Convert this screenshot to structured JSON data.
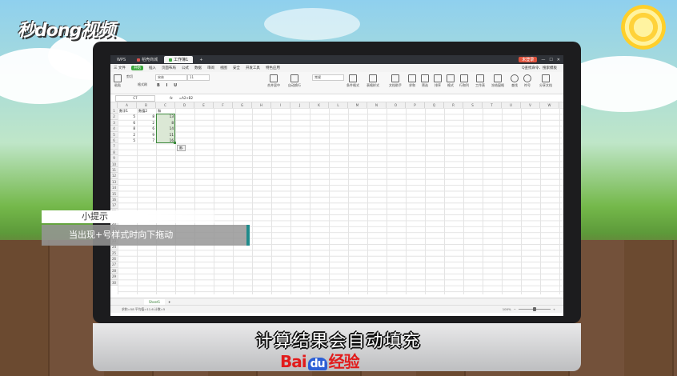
{
  "overlay": {
    "logo": "秒dong视频",
    "tip_title": "小提示",
    "tip_body": "当出现+号样式时向下拖动",
    "subtitle": "计算结果会自动填充",
    "watermark_prefix": "Bai",
    "watermark_du": "du",
    "watermark_suffix": "经验"
  },
  "titlebar": {
    "app": "WPS",
    "tabs": [
      {
        "label": "稻壳商城",
        "color": "#d9534f"
      },
      {
        "label": "工作簿1",
        "color": "#3da73d"
      }
    ],
    "new_tab": "+",
    "login": "未登录"
  },
  "menubar": {
    "file": "三 文件",
    "start": "开始",
    "items": [
      "插入",
      "页面布局",
      "公式",
      "数据",
      "审阅",
      "视图",
      "安全",
      "开发工具",
      "特色应用"
    ],
    "search": "Q查找命令、搜索模板"
  },
  "ribbon": {
    "paste": "粘贴",
    "cut": "剪切",
    "format_painter": "格式刷",
    "font_name": "宋体",
    "font_size": "11",
    "merge": "合并居中",
    "wrap": "自动换行",
    "number_format": "常规",
    "cond_format": "条件格式",
    "table_style": "表格样式",
    "doc_helper": "文档助手",
    "sum": "求和",
    "filter": "筛选",
    "sort": "排序",
    "format": "格式",
    "rowcol": "行和列",
    "worksheet": "工作表",
    "freeze": "冻结窗格",
    "find": "查找",
    "symbol": "符号",
    "share": "分享文档"
  },
  "formula_bar": {
    "cell_ref": "C7",
    "fx": "fx",
    "formula": "=A2+B2"
  },
  "sheet": {
    "columns": [
      "A",
      "B",
      "C",
      "D",
      "E",
      "F",
      "G",
      "H",
      "I",
      "J",
      "K",
      "L",
      "M",
      "N",
      "O",
      "P",
      "Q",
      "R",
      "S",
      "T",
      "U",
      "V",
      "W"
    ],
    "rows": [
      "1",
      "2",
      "3",
      "4",
      "5",
      "6",
      "7",
      "8",
      "9",
      "10",
      "11",
      "12",
      "13",
      "14",
      "15",
      "16",
      "17",
      "18",
      "19",
      "20",
      "21",
      "22",
      "23",
      "24",
      "25",
      "26",
      "27",
      "28",
      "29",
      "30"
    ],
    "headers": [
      "数字1",
      "数值2",
      "和"
    ],
    "data": [
      [
        "5",
        "8",
        "13"
      ],
      [
        "6",
        "2",
        "8"
      ],
      [
        "8",
        "6",
        "14"
      ],
      [
        "2",
        "9",
        "11"
      ],
      [
        "5",
        "7",
        "16"
      ]
    ],
    "autofill_hint": "图-",
    "sheet_tab": "Sheet1"
  },
  "status": {
    "text": "求和=58  平均值=11.6  计数=5",
    "zoom": "100%"
  }
}
